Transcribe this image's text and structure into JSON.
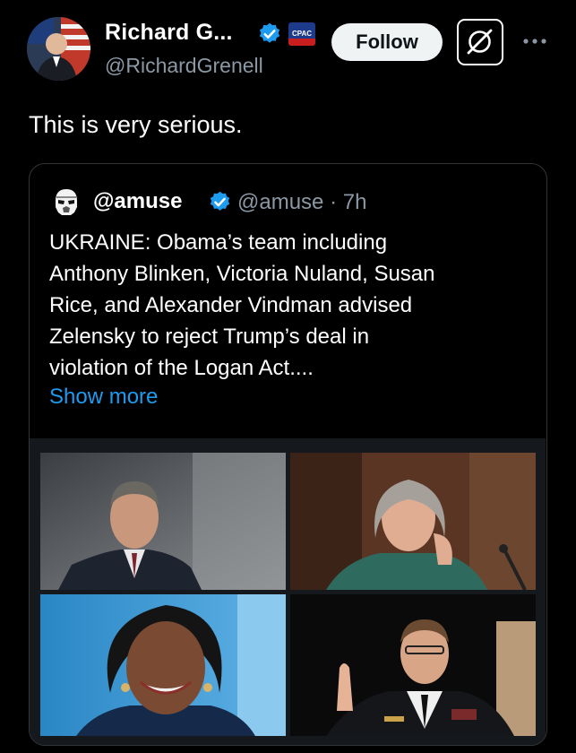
{
  "tweet": {
    "author": {
      "display_name": "Richard G...",
      "handle": "@RichardGrenell",
      "affiliation_badge_text": "CPAC",
      "avatar_icon": "profile-photo"
    },
    "follow_label": "Follow",
    "grok_icon": "grok-icon",
    "more_icon": "more-options-icon",
    "text": "This is very serious."
  },
  "quoted_tweet": {
    "display_name": "@amuse",
    "handle": "@amuse",
    "time_sep": " · ",
    "time": "7h",
    "avatar_icon": "stormtrooper-avatar",
    "body_lines": [
      "UKRAINE: Obama’s team including",
      "Anthony Blinken, Victoria Nuland, Susan",
      "Rice, and Alexander Vindman advised",
      "Zelensky to reject Trump’s deal in",
      "violation of the Logan Act...."
    ],
    "show_more": "Show more",
    "media": [
      {
        "icon": "photo-man-suit"
      },
      {
        "icon": "photo-woman-hearing"
      },
      {
        "icon": "photo-woman-portrait"
      },
      {
        "icon": "photo-officer-oath"
      }
    ]
  },
  "colors": {
    "background": "#000000",
    "text_primary": "#ffffff",
    "text_secondary": "#8b98a5",
    "link": "#1d9bf0",
    "verified": "#1d9bf0",
    "follow_bg": "#eff3f4",
    "card_border": "#333639"
  }
}
